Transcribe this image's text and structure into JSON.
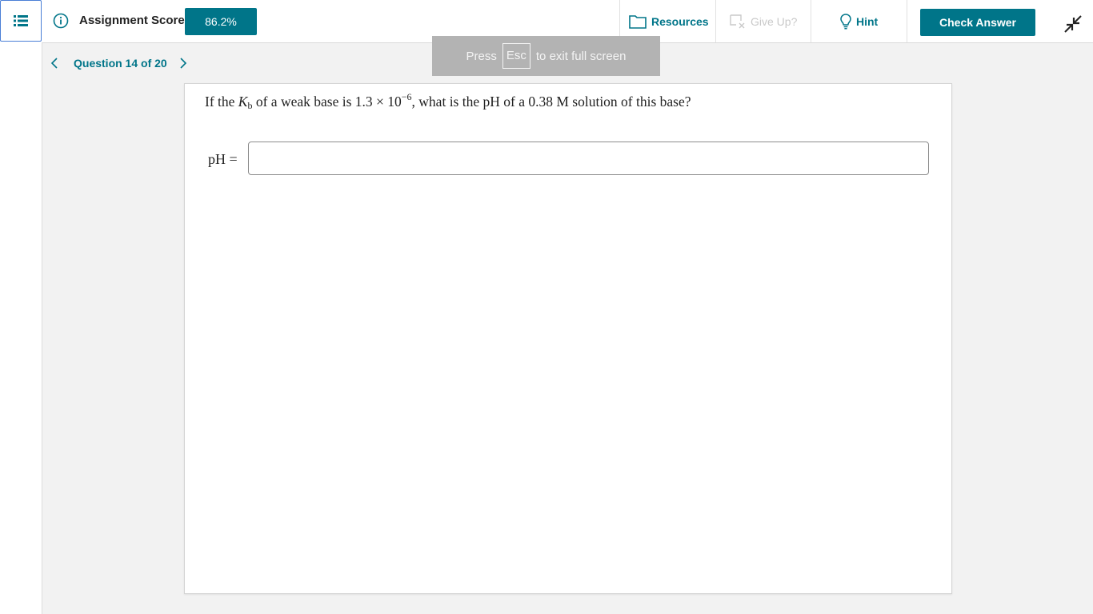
{
  "header": {
    "score_label": "Assignment Score:",
    "score_value": "86.2%",
    "resources_label": "Resources",
    "giveup_label": "Give Up?",
    "hint_label": "Hint",
    "check_answer_label": "Check Answer"
  },
  "colors": {
    "accent": "#007589",
    "disabled": "#c9c9c9",
    "toast_bg": "#b3b3b3"
  },
  "icons": {
    "menu": "list-icon",
    "info": "info-icon",
    "resources": "folder-icon",
    "giveup": "give-up-icon",
    "hint": "lightbulb-icon",
    "collapse": "exit-fullscreen-icon",
    "prev": "chevron-left-icon",
    "next": "chevron-right-icon"
  },
  "nav": {
    "question_label": "Question 14 of 20"
  },
  "toast": {
    "press": "Press",
    "key": "Esc",
    "rest": "to exit full screen"
  },
  "question": {
    "text_prefix": "If the ",
    "k_symbol": "K",
    "k_subscript": "b",
    "text_mid": " of a weak base is 1.3 × 10",
    "exponent": "−6",
    "text_suffix": ", what is the pH of a 0.38 M solution of this base?",
    "answer_label": "pH =",
    "answer_value": ""
  }
}
